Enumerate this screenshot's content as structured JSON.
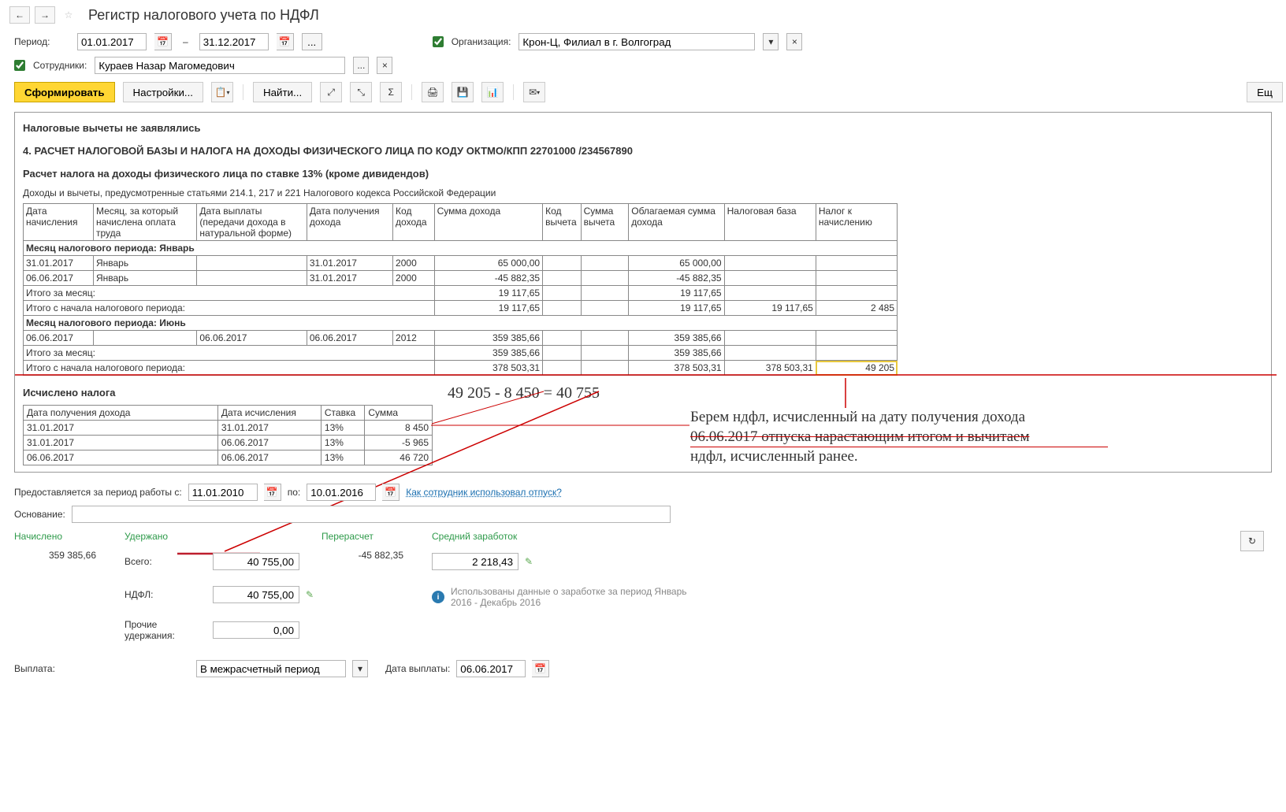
{
  "header": {
    "title": "Регистр налогового учета по НДФЛ"
  },
  "params": {
    "period_label": "Период:",
    "date_from": "01.01.2017",
    "date_to": "31.12.2017",
    "org_label": "Организация:",
    "org_value": "Крон-Ц, Филиал в г. Волгоград",
    "emp_label": "Сотрудники:",
    "emp_value": "Кураев Назар Магомедович"
  },
  "toolbar": {
    "form": "Сформировать",
    "settings": "Настройки...",
    "find": "Найти...",
    "eur": "Ещ"
  },
  "report": {
    "deductions": "Налоговые вычеты не заявлялись",
    "section4": "4. РАСЧЕТ НАЛОГОВОЙ БАЗЫ И НАЛОГА НА ДОХОДЫ ФИЗИЧЕСКОГО ЛИЦА ПО КОДУ ОКТМО/КПП 22701000   /234567890",
    "calc13": "Расчет налога на доходы физического лица по ставке 13% (кроме дивидендов)",
    "codex": "Доходы и вычеты, предусмотренные статьями 214.1, 217 и 221 Налогового кодекса Российской Федерации",
    "th": {
      "c1": "Дата начисления",
      "c2": "Месяц, за который начислена оплата труда",
      "c3": "Дата выплаты (передачи дохода в натуральной форме)",
      "c4": "Дата получения дохода",
      "c5": "Код дохода",
      "c6": "Сумма дохода",
      "c7": "Код вычета",
      "c8": "Сумма вычета",
      "c9": "Облагаемая сумма дохода",
      "c10": "Налоговая база",
      "c11": "Налог к начислению"
    },
    "mjan": "Месяц налогового периода: Январь",
    "r1": {
      "d1": "31.01.2017",
      "d2": "Январь",
      "d4": "31.01.2017",
      "d5": "2000",
      "d6": "65 000,00",
      "d9": "65 000,00"
    },
    "r2": {
      "d1": "06.06.2017",
      "d2": "Январь",
      "d4": "31.01.2017",
      "d5": "2000",
      "d6": "-45 882,35",
      "d9": "-45 882,35"
    },
    "itm": "Итого за месяц:",
    "itm1": {
      "d6": "19 117,65",
      "d9": "19 117,65"
    },
    "itp": "Итого с начала налогового периода:",
    "itp1": {
      "d6": "19 117,65",
      "d9": "19 117,65",
      "d10": "19 117,65",
      "d11": "2 485"
    },
    "mjun": "Месяц налогового периода: Июнь",
    "r3": {
      "d1": "06.06.2017",
      "d3": "06.06.2017",
      "d4": "06.06.2017",
      "d5": "2012",
      "d6": "359 385,66",
      "d9": "359 385,66"
    },
    "itm2": {
      "d6": "359 385,66",
      "d9": "359 385,66"
    },
    "itp2": {
      "d6": "378 503,31",
      "d9": "378 503,31",
      "d10": "378 503,31",
      "d11": "49 205"
    },
    "taxcalc_title": "Исчислено налога",
    "tth": {
      "c1": "Дата получения дохода",
      "c2": "Дата исчисления",
      "c3": "Ставка",
      "c4": "Сумма"
    },
    "tr1": {
      "c1": "31.01.2017",
      "c2": "31.01.2017",
      "c3": "13%",
      "c4": "8 450"
    },
    "tr2": {
      "c1": "31.01.2017",
      "c2": "06.06.2017",
      "c3": "13%",
      "c4": "-5 965"
    },
    "tr3": {
      "c1": "06.06.2017",
      "c2": "06.06.2017",
      "c3": "13%",
      "c4": "46 720"
    }
  },
  "annotation": {
    "formula": "49 205 - 8 450 =   40 755",
    "line1": "Берем ндфл, исчисленный на дату получения дохода",
    "line2": "06.06.2017 отпуска нарастающим итогом и вычитаем",
    "line3": "ндфл, исчисленный ранее."
  },
  "lower": {
    "period_label": "Предоставляется за период работы с:",
    "pd_from": "11.01.2010",
    "po": "по:",
    "pd_to": "10.01.2016",
    "link": "Как сотрудник использовал отпуск?",
    "osnov": "Основание:",
    "nach": "Начислено",
    "nach_val": "359 385,66",
    "uder": "Удержано",
    "vsego": "Всего:",
    "vsego_v": "40 755,00",
    "ndfl": "НДФЛ:",
    "ndfl_v": "40 755,00",
    "other": "Прочие удержания:",
    "other_v": "0,00",
    "perer": "Перерасчет",
    "perer_v": "-45 882,35",
    "sred": "Средний заработок",
    "sred_v": "2 218,43",
    "info": "Использованы данные о заработке за период Январь 2016 - Декабрь 2016",
    "vypl": "Выплата:",
    "vypl_sel": "В межрасчетный период",
    "vypl_date_l": "Дата выплаты:",
    "vypl_date": "06.06.2017"
  }
}
